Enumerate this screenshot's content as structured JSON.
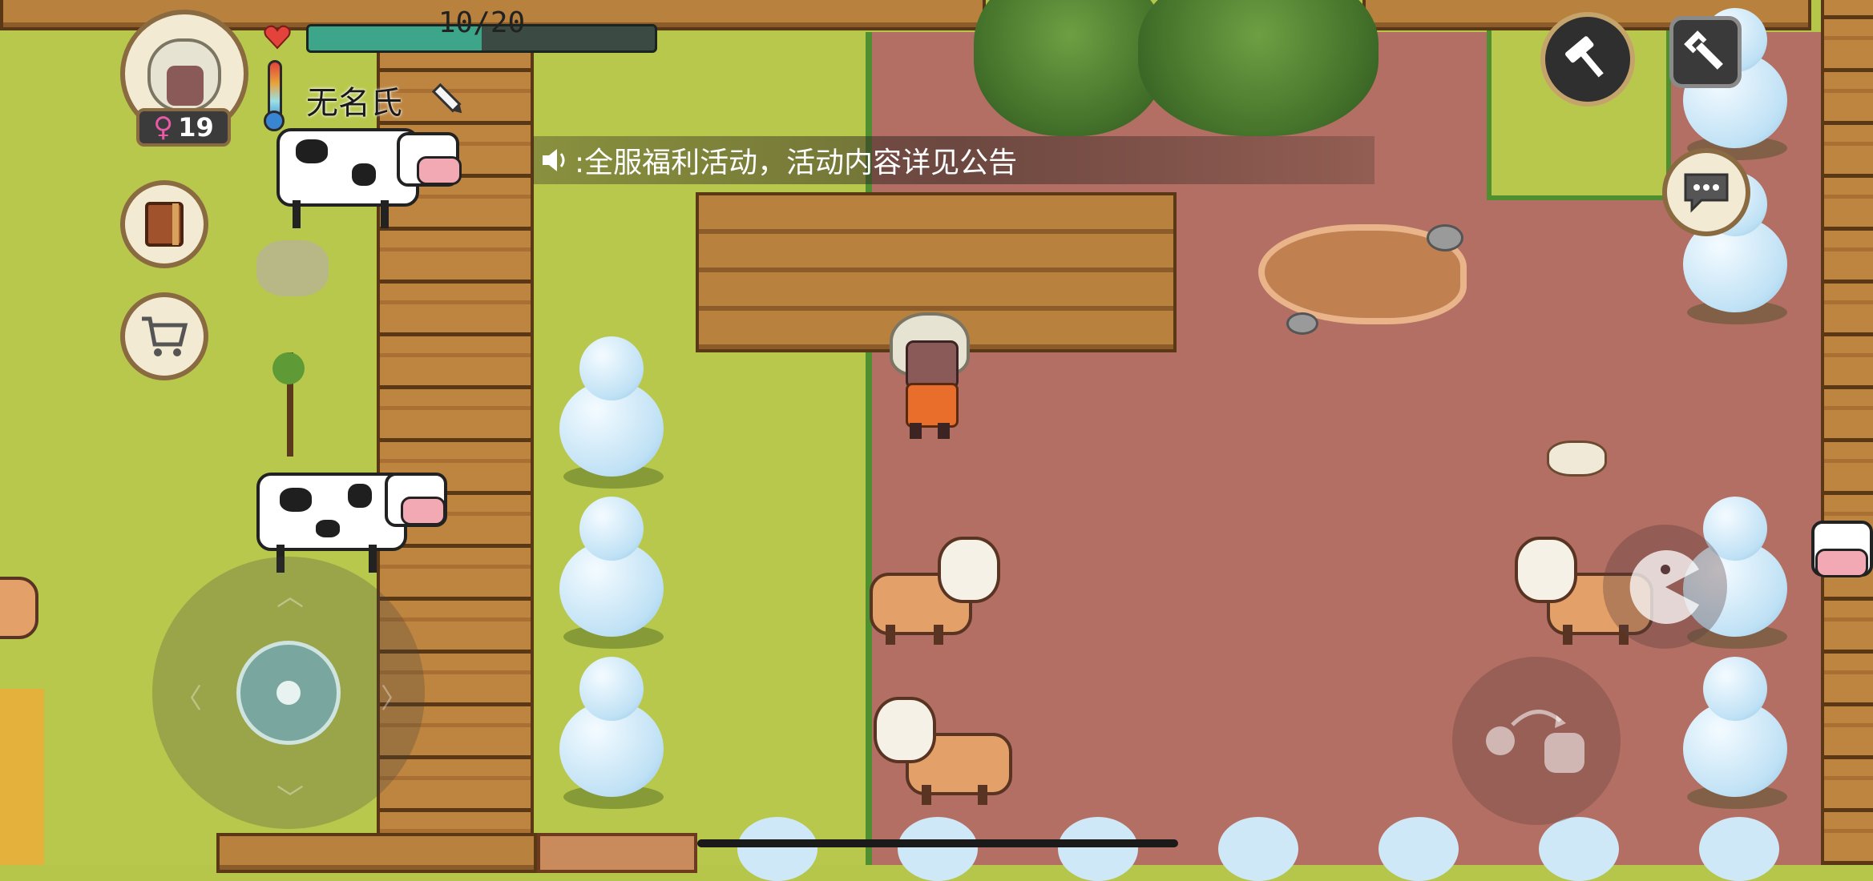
{
  "player": {
    "health_text": "10/20",
    "health_fraction": 0.5,
    "name": "无名氏",
    "level": "19",
    "gender_symbol": "♀"
  },
  "announcement": {
    "text": ":全服福利活动，活动内容详见公告"
  },
  "icons": {
    "heart": "heart-icon",
    "thermometer": "thermometer-icon",
    "edit": "pencil-icon",
    "journal": "book-icon",
    "shop": "cart-icon",
    "hammer": "hammer-icon",
    "settings": "wrench-icon",
    "chat": "chat-bubble-icon",
    "speaker": "speaker-icon",
    "eat": "pacman-icon",
    "throw": "throw-hand-icon",
    "joystick": "joystick-icon"
  },
  "colors": {
    "health_bar": "#3da58a",
    "health_bar_bg": "#3b4a42",
    "grass": "#b8c84c",
    "dirt": "#b36f63",
    "wood": "#b8823e"
  }
}
